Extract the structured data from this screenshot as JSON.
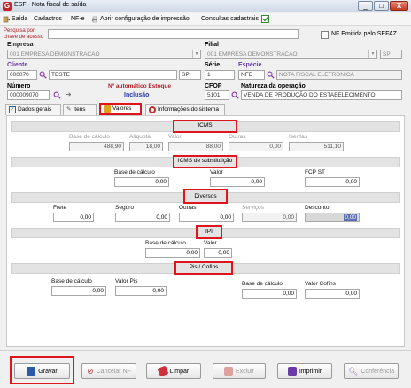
{
  "window": {
    "title": "ESF - Nota fiscal de saída",
    "minimize": "_",
    "maximize": "□",
    "close": "X"
  },
  "menu": {
    "items": [
      {
        "label": "Saída"
      },
      {
        "label": "Cadastros"
      },
      {
        "label": "NF-e"
      },
      {
        "label": "Abrir configuração de impressão"
      },
      {
        "label": "Consultas cadastrais"
      }
    ]
  },
  "header": {
    "search_label": "Pesquisa por chave de acesso",
    "search_value": "",
    "nf_sefaz_label": "NF Emitida pelo SEFAZ"
  },
  "empresa": {
    "label": "Empresa",
    "value": "001 EMPRESA DEMONSTRACAO"
  },
  "filial": {
    "label": "Filial",
    "value": "001 EMPRESA DEMONSTRACAO",
    "uf": "SP"
  },
  "cliente": {
    "label": "Cliente",
    "code": "000070",
    "name": "TESTE",
    "uf": "SP"
  },
  "serie": {
    "label": "Série",
    "value": "1"
  },
  "especie": {
    "label": "Espécie",
    "code": "NFE",
    "name": "NOTA FISCAL ELETRONICA"
  },
  "numero": {
    "label": "Número",
    "value": "000009070"
  },
  "estoque": {
    "label": "Nº automático Estoque",
    "value": "Inclusão"
  },
  "cfop": {
    "label": "CFOP",
    "value": "5101"
  },
  "natureza": {
    "label": "Natureza da operação",
    "value": "VENDA DE PRODUÇÃO DO ESTABELECIMENTO"
  },
  "tabs": [
    {
      "label": "Dados gerais"
    },
    {
      "label": "Itens"
    },
    {
      "label": "Valores"
    },
    {
      "label": "Informações do sistema"
    }
  ],
  "icms": {
    "title": "ICMS",
    "labels": [
      "Base de cálculo",
      "Alíquota",
      "Valor",
      "Outras",
      "Isentas"
    ],
    "values": [
      "488,90",
      "18,00",
      "88,00",
      "0,00",
      "511,10"
    ]
  },
  "icms_st": {
    "title": "ICMS de substituição",
    "labels": [
      "Base de cálculo",
      "Valor",
      "FCP ST"
    ],
    "values": [
      "0,00",
      "0,00",
      "0,00"
    ]
  },
  "diversos": {
    "title": "Diversos",
    "labels": [
      "Frete",
      "Seguro",
      "Outras",
      "Serviços",
      "Desconto"
    ],
    "values": [
      "0,00",
      "0,00",
      "0,00",
      "0,00",
      "0,00"
    ]
  },
  "ipi": {
    "title": "IPI",
    "labels": [
      "Base de cálculo",
      "Valor"
    ],
    "values": [
      "0,00",
      "0,00"
    ]
  },
  "pis_cofins": {
    "title": "Pis / Cofins",
    "labels": [
      "Base de cálculo",
      "Valor Pis",
      "Base de cálculo",
      "Valor Cofins"
    ],
    "values": [
      "0,00",
      "0,00",
      "0,00",
      "0,00"
    ]
  },
  "buttons": {
    "gravar": "Gravar",
    "cancelar": "Cancelar NF",
    "limpar": "Limpar",
    "excluir": "Excluir",
    "imprimir": "Imprimir",
    "conferencia": "Conferência"
  }
}
